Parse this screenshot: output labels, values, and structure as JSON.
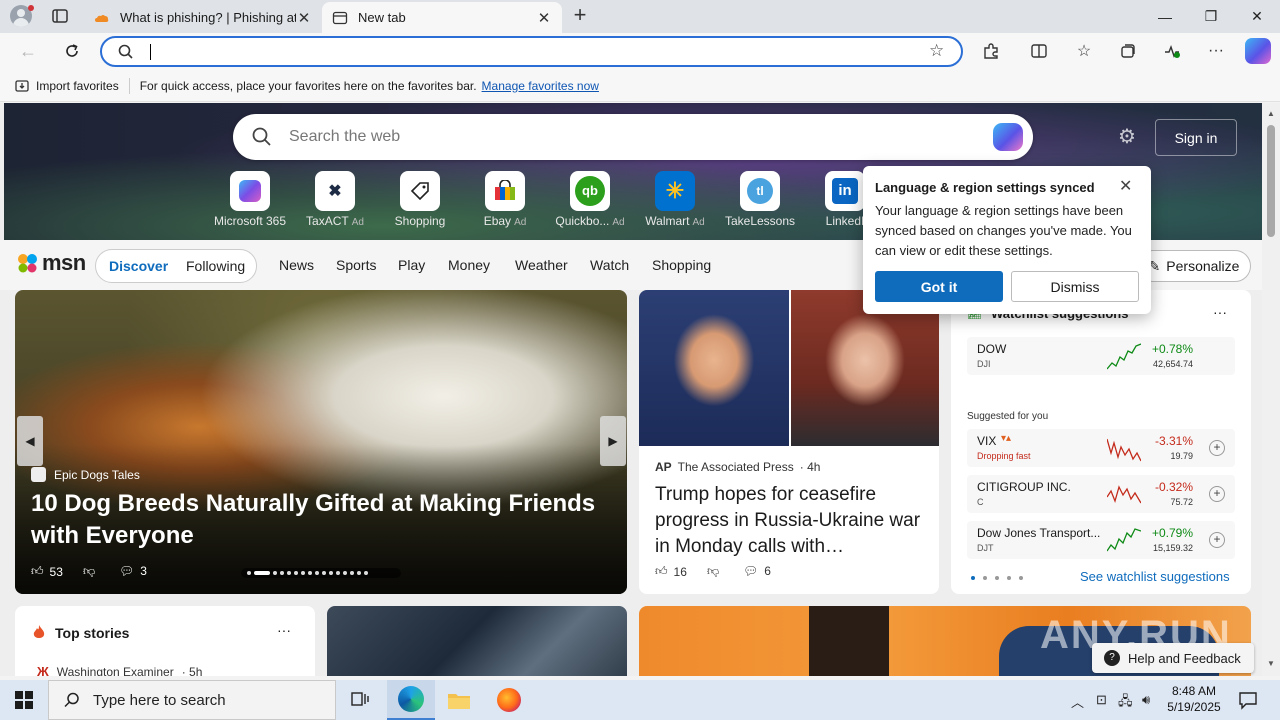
{
  "browser": {
    "tabs": [
      {
        "title": "What is phishing? | Phishing atta",
        "active": false
      },
      {
        "title": "New tab",
        "active": true
      }
    ],
    "address_value": "",
    "favorites_bar": {
      "import_label": "Import favorites",
      "message": "For quick access, place your favorites here on the favorites bar.",
      "manage_link": "Manage favorites now"
    }
  },
  "newtab": {
    "search_placeholder": "Search the web",
    "sign_in": "Sign in",
    "quick_links": [
      {
        "label": "Microsoft 365",
        "ad": ""
      },
      {
        "label": "TaxACT",
        "ad": "Ad"
      },
      {
        "label": "Shopping",
        "ad": ""
      },
      {
        "label": "Ebay",
        "ad": "Ad"
      },
      {
        "label": "Quickbo...",
        "ad": "Ad"
      },
      {
        "label": "Walmart",
        "ad": "Ad"
      },
      {
        "label": "TakeLessons",
        "ad": ""
      },
      {
        "label": "LinkedI",
        "ad": ""
      }
    ],
    "feed_tabs": {
      "discover": "Discover",
      "following": "Following"
    },
    "nav": [
      "News",
      "Sports",
      "Play",
      "Money",
      "Weather",
      "Watch",
      "Shopping"
    ],
    "personalize": "Personalize"
  },
  "hero": {
    "source": "Epic Dogs Tales",
    "headline": "10 Dog Breeds Naturally Gifted at Making Friends with Everyone",
    "likes": "53",
    "comments": "3"
  },
  "news": {
    "source": "The Associated Press",
    "source_logo": "AP",
    "age": "· 4h",
    "headline": "Trump hopes for ceasefire progress in Russia-Ukraine war in Monday calls with…",
    "likes": "16",
    "comments": "6"
  },
  "watchlist": {
    "title": "Watchlist suggestions",
    "suggested_label": "Suggested for you",
    "see_more": "See watchlist suggestions",
    "stocks": [
      {
        "name": "DOW",
        "symbol": "DJI",
        "change": "+0.78%",
        "price": "42,654.74",
        "direction": "up"
      },
      {
        "name": "VIX",
        "symbol": "Dropping fast",
        "change": "-3.31%",
        "price": "19.79",
        "direction": "down"
      },
      {
        "name": "CITIGROUP INC.",
        "symbol": "C",
        "change": "-0.32%",
        "price": "75.72",
        "direction": "down"
      },
      {
        "name": "Dow Jones Transport...",
        "symbol": "DJT",
        "change": "+0.79%",
        "price": "15,159.32",
        "direction": "up"
      }
    ]
  },
  "top_stories": {
    "title": "Top stories",
    "source": "Washington Examiner",
    "age": "· 5h"
  },
  "popup": {
    "title": "Language & region settings synced",
    "body": "Your language & region settings have been synced based on changes you've made. You can view or edit these settings.",
    "primary": "Got it",
    "secondary": "Dismiss"
  },
  "feedback": "Help and Feedback",
  "taskbar": {
    "search_placeholder": "Type here to search",
    "time": "8:48 AM",
    "date": "5/19/2025"
  },
  "colors": {
    "accent": "#0f6cbd",
    "positive": "#0e8a16",
    "negative": "#c42b1c"
  }
}
